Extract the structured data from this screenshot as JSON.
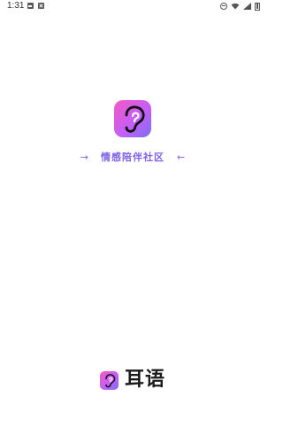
{
  "status_bar": {
    "time": "1:31",
    "left_icons": [
      "gallery-icon",
      "notification-icon"
    ],
    "right_icons": [
      "do-not-disturb-icon",
      "wifi-icon",
      "signal-icon",
      "battery-icon"
    ]
  },
  "splash": {
    "app_icon": "ear-icon",
    "slogan_left_mark": "→",
    "slogan": "情感陪伴社区",
    "slogan_right_mark": "←"
  },
  "brand": {
    "name": "耳语",
    "logo_icon": "ear-icon"
  },
  "colors": {
    "accent": "#7f63e9",
    "gradient_start": "#f35ac2",
    "gradient_end": "#7b6ef0",
    "text_dark": "#1b1b1b",
    "background": "#ffffff"
  }
}
